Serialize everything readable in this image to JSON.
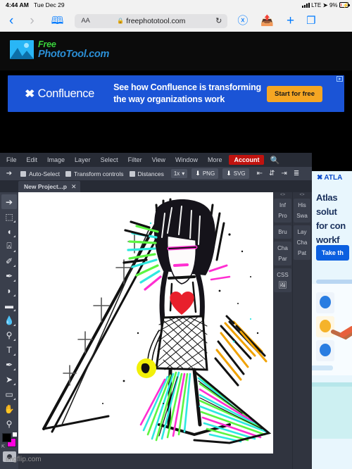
{
  "status_bar": {
    "time": "4:44 AM",
    "date": "Tue Dec 29",
    "network": "LTE",
    "battery_percent": "9%",
    "location_icon": "location-arrow-icon",
    "signal_icon": "signal-bars-icon",
    "battery_icon": "battery-charging-icon"
  },
  "browser": {
    "back_icon": "chevron-left-icon",
    "forward_icon": "chevron-right-icon",
    "bookmarks_icon": "book-icon",
    "reader_label": "AA",
    "lock_icon": "lock-icon",
    "url": "freephototool.com",
    "reload_icon": "reload-icon",
    "download_icon": "download-circle-icon",
    "share_icon": "share-up-icon",
    "new_tab_icon": "plus-icon",
    "tabs_icon": "tabs-icon"
  },
  "site": {
    "logo": {
      "line1": "Free",
      "line2": "PhotoTool.com",
      "icon": "photo-mountain-icon",
      "green": "#39d13b",
      "blue": "#2b8fd6"
    }
  },
  "ad_top": {
    "brand": "Confluence",
    "brand_icon": "confluence-logo-icon",
    "headline_line1": "See how Confluence is transforming",
    "headline_line2": "the way organizations work",
    "cta": "Start for free",
    "bg_color": "#1b54d6",
    "cta_color": "#f5a623",
    "adchoices_icon": "adchoices-icon"
  },
  "ad_right": {
    "brand": "ATLA",
    "brand_icon": "atlassian-logo-icon",
    "copy_lines": [
      "Atlas",
      "solut",
      "for con",
      "workf"
    ],
    "cta": "Take th",
    "bg_color": "#e8f6fd",
    "cta_color": "#0b5fe0"
  },
  "editor": {
    "menu": [
      {
        "label": "File"
      },
      {
        "label": "Edit"
      },
      {
        "label": "Image"
      },
      {
        "label": "Layer"
      },
      {
        "label": "Select"
      },
      {
        "label": "Filter"
      },
      {
        "label": "View"
      },
      {
        "label": "Window"
      },
      {
        "label": "More"
      }
    ],
    "account_label": "Account",
    "account_color": "#c0130f",
    "search_icon": "search-icon",
    "options_bar": {
      "tool_icon": "move-tool-icon",
      "checkboxes": [
        {
          "label": "Auto-Select",
          "checked": true
        },
        {
          "label": "Transform controls",
          "checked": true
        },
        {
          "label": "Distances",
          "checked": true
        }
      ],
      "zoom_select": "1x",
      "zoom_caret_icon": "chevron-down-icon",
      "export_png": "PNG",
      "export_svg": "SVG",
      "download_icon": "download-arrow-icon",
      "align_icons": [
        "align-left-icon",
        "align-center-icon",
        "align-right-icon",
        "distribute-icon"
      ]
    },
    "tab": {
      "label": "New Project...p",
      "close_icon": "close-icon"
    },
    "tools": [
      {
        "name": "move-tool",
        "glyph": "↖",
        "selected": true
      },
      {
        "name": "marquee-tool",
        "glyph": "⬚",
        "selected": false
      },
      {
        "name": "lasso-tool",
        "glyph": "◖",
        "selected": false
      },
      {
        "name": "crop-tool",
        "glyph": "⌗",
        "selected": false
      },
      {
        "name": "patch-tool",
        "glyph": "✐",
        "selected": false
      },
      {
        "name": "brush-tool",
        "glyph": "✎",
        "selected": false
      },
      {
        "name": "eraser-tool",
        "glyph": "◗",
        "selected": false
      },
      {
        "name": "gradient-tool",
        "glyph": "▬",
        "selected": false
      },
      {
        "name": "blur-tool",
        "glyph": "●",
        "selected": false
      },
      {
        "name": "dodge-tool",
        "glyph": "⚲",
        "selected": false
      },
      {
        "name": "text-tool",
        "glyph": "T",
        "selected": false
      },
      {
        "name": "eyedropper-tool",
        "glyph": "✒",
        "selected": false
      },
      {
        "name": "path-select-tool",
        "glyph": "➤",
        "selected": false
      },
      {
        "name": "shape-tool",
        "glyph": "▭",
        "selected": false
      },
      {
        "name": "hand-tool",
        "glyph": "✋",
        "selected": false
      },
      {
        "name": "zoom-tool",
        "glyph": "⚲",
        "selected": false
      }
    ],
    "colors": {
      "foreground": "#000000",
      "background": "#ff00e0",
      "swap_icon": "swap-colors-icon",
      "default_icon": "default-colors-icon",
      "quick_mask_icon": "quick-mask-icon"
    },
    "panel_rail_left": [
      "Inf",
      "Pro",
      "Bru",
      "Cha",
      "Par",
      "CSS"
    ],
    "panel_rail_left_icon": "image-panel-icon",
    "panel_rail_right": [
      "His",
      "Swa",
      "Lay",
      "Cha",
      "Pat"
    ],
    "collapse_icon": "<>"
  },
  "artwork": {
    "description": "hand-drawn figure with black hair, red heart, neon green and cyan fringe, orange-black feathers, fishnet, crosses",
    "canvas_bg": "#ffffff",
    "palette": {
      "black": "#111111",
      "neon_green": "#5cf542",
      "cyan": "#2fe8e0",
      "magenta": "#ff2ed1",
      "yellow": "#f2f008",
      "orange": "#f0a202",
      "red": "#e8202c",
      "pink": "#ff4fb0"
    }
  },
  "watermark": "imgflip.com"
}
